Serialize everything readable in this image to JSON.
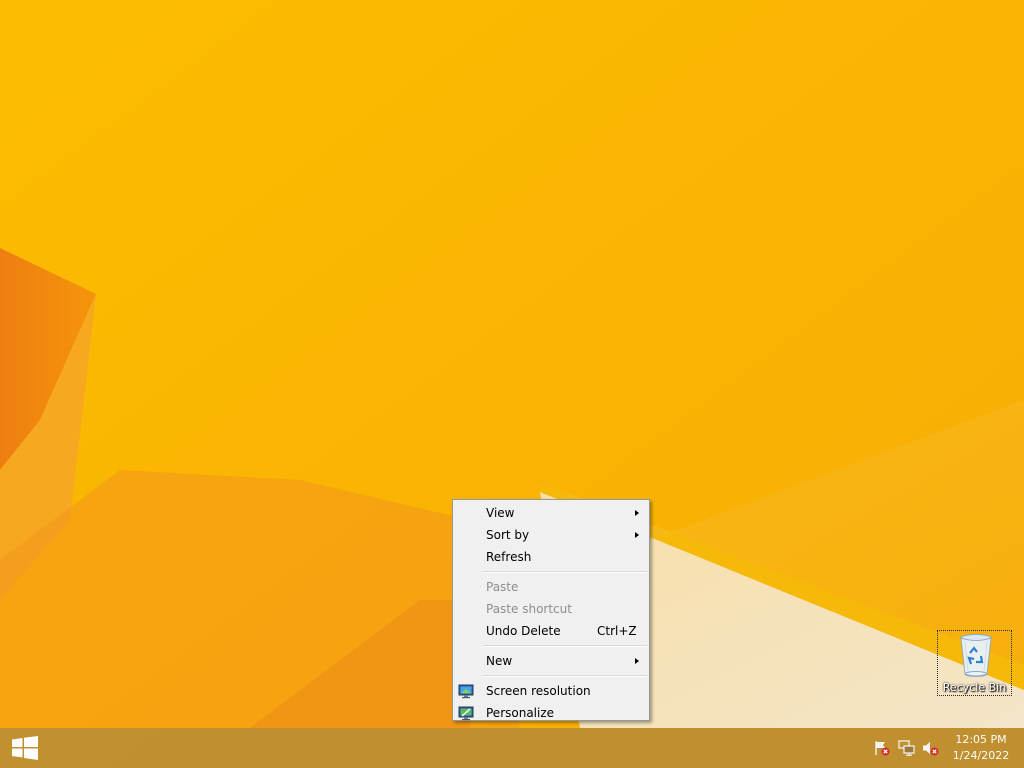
{
  "context_menu": {
    "items": [
      {
        "label": "View",
        "submenu": true
      },
      {
        "label": "Sort by",
        "submenu": true
      },
      {
        "label": "Refresh"
      },
      {
        "label": "Paste",
        "disabled": true
      },
      {
        "label": "Paste shortcut",
        "disabled": true
      },
      {
        "label": "Undo Delete",
        "shortcut": "Ctrl+Z"
      },
      {
        "label": "New",
        "submenu": true
      },
      {
        "label": "Screen resolution",
        "icon": "screen-resolution-icon"
      },
      {
        "label": "Personalize",
        "icon": "personalize-icon"
      }
    ]
  },
  "desktop": {
    "icons": [
      {
        "label": "Recycle Bin",
        "icon": "recycle-bin-icon",
        "selected": true
      }
    ]
  },
  "taskbar": {
    "start_icon": "windows-logo-icon",
    "tray_icons": [
      "action-center-flag-icon",
      "network-icon",
      "volume-muted-icon"
    ],
    "clock": {
      "time": "12:05 PM",
      "date": "1/24/2022"
    }
  },
  "colors": {
    "wallpaper": "#fbb800",
    "menu_bg": "#f0f0f0",
    "taskbar": "#af873c"
  }
}
